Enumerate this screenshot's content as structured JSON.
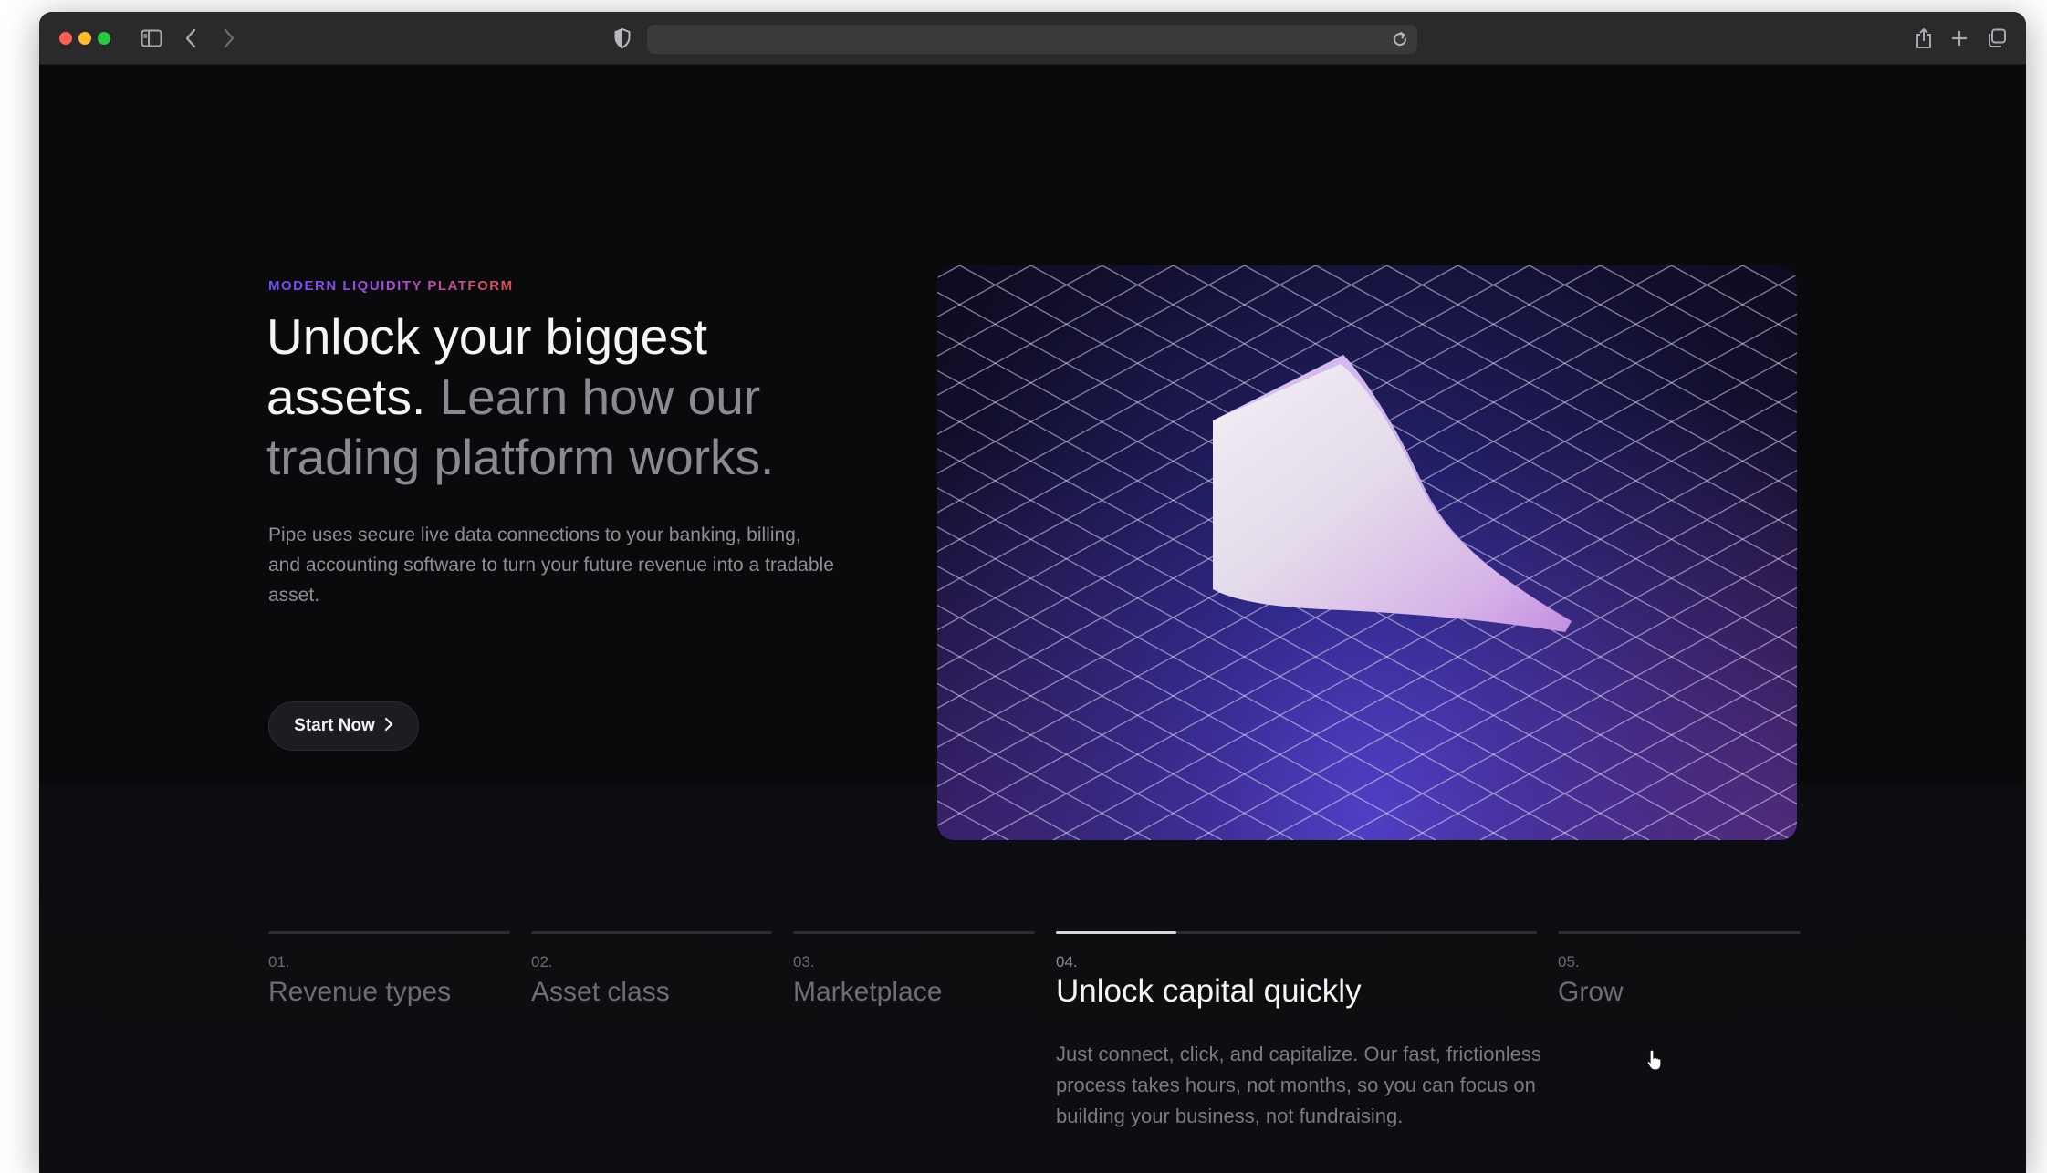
{
  "browser": {
    "url_value": "",
    "icons": [
      "sidebar-toggle-icon",
      "back-chevron-icon",
      "forward-chevron-icon",
      "shield-icon",
      "reload-icon",
      "share-icon",
      "plus-icon",
      "tabs-overview-icon"
    ]
  },
  "hero": {
    "eyebrow": "MODERN LIQUIDITY PLATFORM",
    "headline_strong": "Unlock your biggest assets.",
    "headline_muted": "Learn how our trading platform works.",
    "description": "Pipe uses secure live data connections to your banking, billing, and accounting software to turn your future revenue into a tradable asset.",
    "cta_label": "Start Now",
    "cta_icon": "chevron-right-icon"
  },
  "steps": [
    {
      "number": "01.",
      "title": "Revenue types",
      "active": false
    },
    {
      "number": "02.",
      "title": "Asset class",
      "active": false
    },
    {
      "number": "03.",
      "title": "Marketplace",
      "active": false
    },
    {
      "number": "04.",
      "title": "Unlock capital quickly",
      "active": true,
      "progress_percent": 25,
      "description": "Just connect, click, and capitalize. Our fast, frictionless process takes hours, not months, so you can focus on building your business, not fundraising."
    },
    {
      "number": "05.",
      "title": "Grow",
      "active": false
    }
  ],
  "colors": {
    "eyebrow_gradient_start": "#6d4cff",
    "eyebrow_gradient_end": "#e0534a",
    "page_background": "#0a0a0c"
  }
}
